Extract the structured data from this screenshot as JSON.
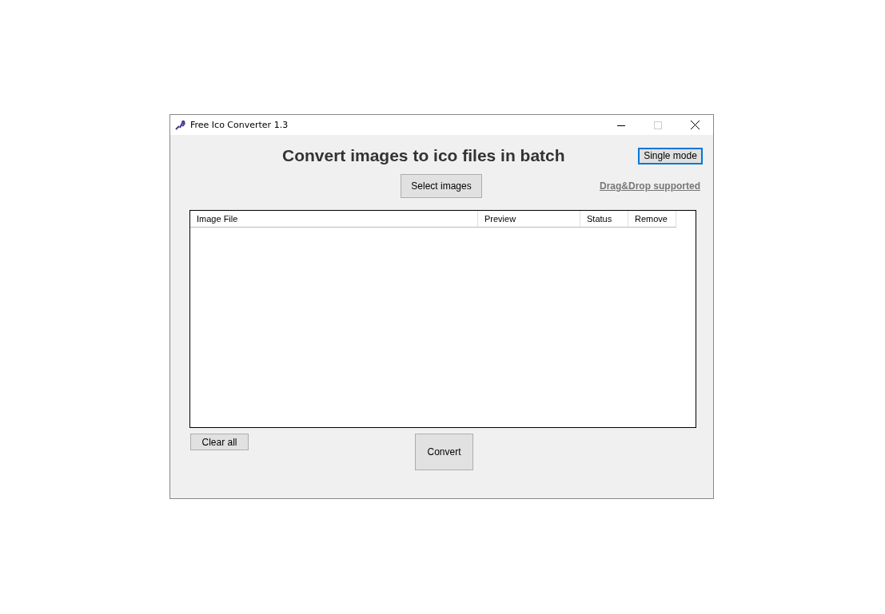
{
  "window": {
    "title": "Free Ico Converter 1.3",
    "controls": [
      {
        "kind": "minimize",
        "disabled": false
      },
      {
        "kind": "maximize",
        "disabled": true
      },
      {
        "kind": "close",
        "disabled": false
      }
    ]
  },
  "heading": "Convert images to ico files in batch",
  "mode_button": {
    "label": "Single mode",
    "focused": true
  },
  "select_button": "Select images",
  "drag_drop_note": "Drag&Drop supported",
  "table": {
    "columns": [
      "Image File",
      "Preview",
      "Status",
      "Remove"
    ]
  },
  "clear_button": "Clear all",
  "convert_button": "Convert"
}
